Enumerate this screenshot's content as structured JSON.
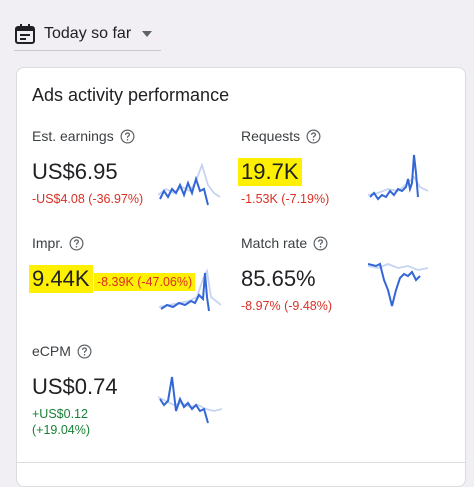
{
  "date_selector": {
    "label": "Today so far",
    "icon": "calendar-icon"
  },
  "card": {
    "title": "Ads activity performance",
    "metrics": [
      {
        "key": "est_earnings",
        "label": "Est. earnings",
        "value": "US$6.95",
        "change": "-US$4.08 (-36.97%)",
        "trend": "down",
        "value_highlighted": false,
        "change_highlighted": false
      },
      {
        "key": "requests",
        "label": "Requests",
        "value": "19.7K",
        "change": "-1.53K (-7.19%)",
        "trend": "down",
        "value_highlighted": true,
        "change_highlighted": false
      },
      {
        "key": "impr",
        "label": "Impr.",
        "value": "9.44K",
        "change": "-8.39K (-47.06%)",
        "trend": "down",
        "value_highlighted": true,
        "change_highlighted": true
      },
      {
        "key": "match_rate",
        "label": "Match rate",
        "value": "85.65%",
        "change": "-8.97% (-9.48%)",
        "trend": "down",
        "value_highlighted": false,
        "change_highlighted": false
      },
      {
        "key": "ecpm",
        "label": "eCPM",
        "value": "US$0.74",
        "change_line1": "+US$0.12",
        "change_line2": "(+19.04%)",
        "trend": "up",
        "value_highlighted": false,
        "change_highlighted": false
      }
    ]
  },
  "colors": {
    "current_series": "#3367d6",
    "previous_series": "#c6d3f3",
    "negative": "#d93025",
    "positive": "#188038",
    "highlight": "#ffef00"
  }
}
